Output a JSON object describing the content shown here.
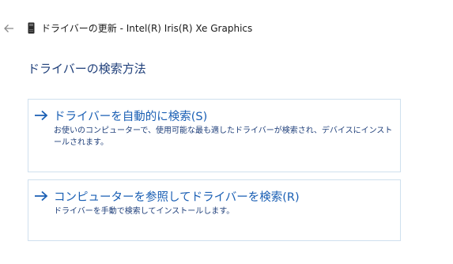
{
  "header": {
    "back_icon": "back-arrow-icon",
    "device_icon": "device-icon",
    "title": "ドライバーの更新 - Intel(R) Iris(R) Xe Graphics"
  },
  "main": {
    "heading": "ドライバーの検索方法",
    "options": [
      {
        "icon": "arrow-right-icon",
        "title": "ドライバーを自動的に検索(S)",
        "description": "お使いのコンピューターで、使用可能な最も適したドライバーが検索され、デバイスにインストールされます。"
      },
      {
        "icon": "arrow-right-icon",
        "title": "コンピューターを参照してドライバーを検索(R)",
        "description": "ドライバーを手動で検索してインストールします。"
      }
    ]
  },
  "colors": {
    "accent": "#1a5fb4",
    "heading": "#1f3f7a",
    "border": "#cfe0ee"
  }
}
